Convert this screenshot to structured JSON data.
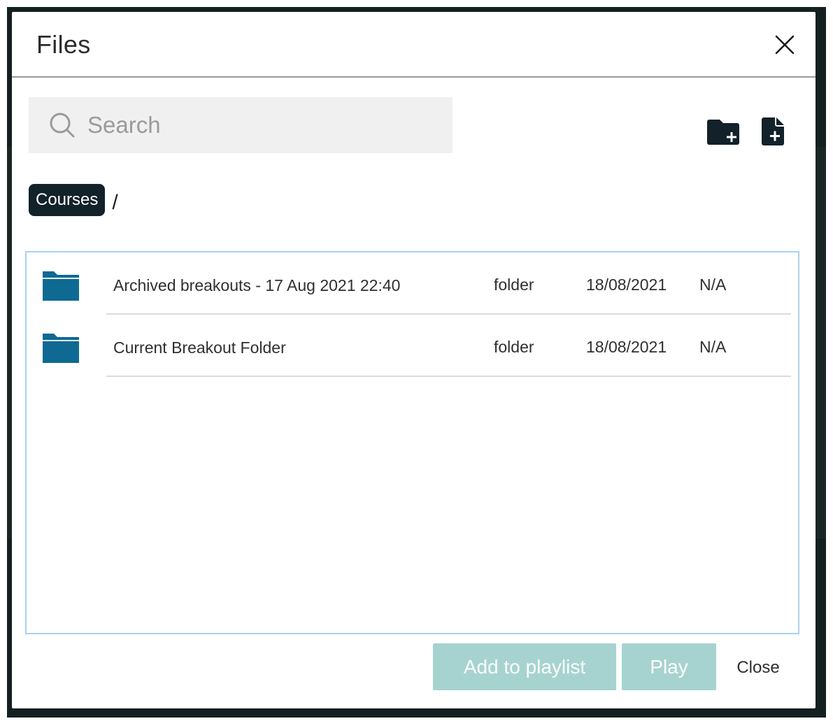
{
  "dialog": {
    "title": "Files"
  },
  "search": {
    "placeholder": "Search",
    "value": ""
  },
  "breadcrumb": {
    "items": [
      "Courses"
    ],
    "separator": "/"
  },
  "files": [
    {
      "name": "Archived breakouts - 17 Aug 2021 22:40",
      "type": "folder",
      "date": "18/08/2021",
      "size": "N/A",
      "icon": "folder-icon"
    },
    {
      "name": "Current Breakout Folder",
      "type": "folder",
      "date": "18/08/2021",
      "size": "N/A",
      "icon": "folder-icon"
    }
  ],
  "footer": {
    "add_label": "Add to playlist",
    "play_label": "Play",
    "close_label": "Close"
  },
  "colors": {
    "primary_dark": "#12212a",
    "folder_blue": "#0e6a93",
    "button_disabled_teal": "#a6d3d0",
    "list_border": "#a9d1f2",
    "search_bg": "#f0f0f0"
  }
}
